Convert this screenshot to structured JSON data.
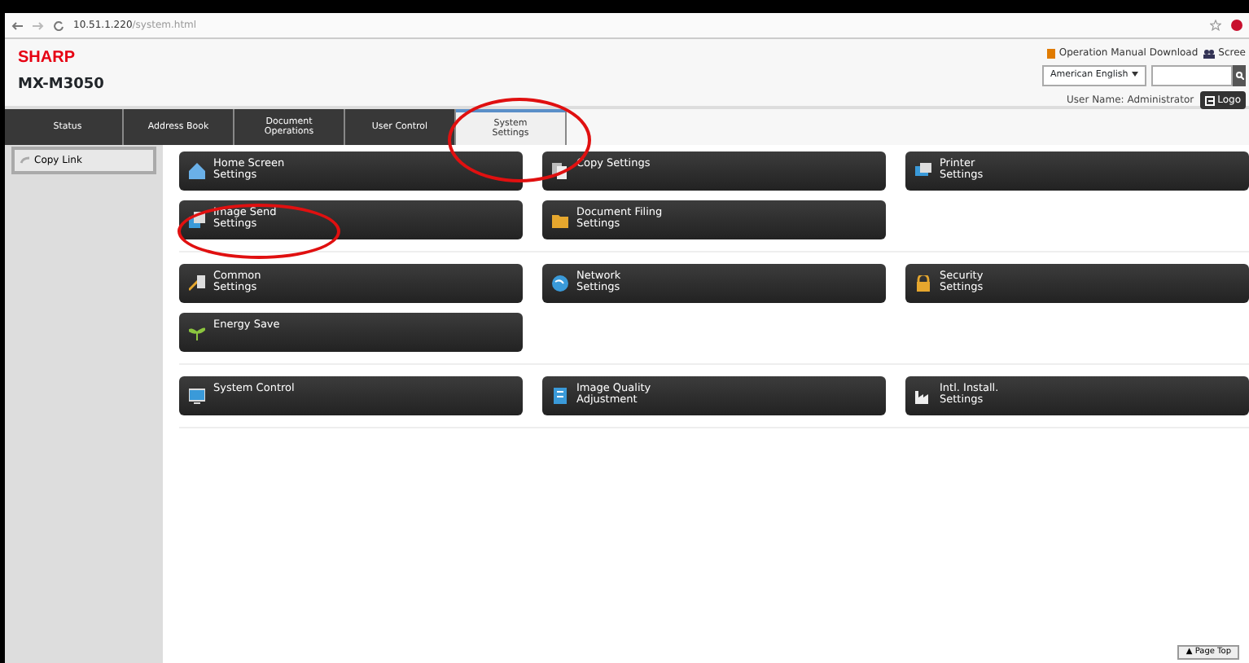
{
  "browser": {
    "url": "10.51.1.220",
    "url_path": "/system.html"
  },
  "header": {
    "brand": "SHARP",
    "model": "MX-M3050",
    "links": [
      {
        "kind": "manual",
        "label": "Operation Manual Download"
      },
      {
        "kind": "screen",
        "label": "Scree"
      }
    ],
    "language": "American English",
    "user_label": "User Name:",
    "user_name": "Administrator",
    "logout": "Logo"
  },
  "tabs": [
    {
      "label": "Status",
      "selected": false,
      "highlighted": false
    },
    {
      "label": "Address Book",
      "selected": false,
      "highlighted": false
    },
    {
      "label": "Document\nOperations",
      "selected": false,
      "highlighted": false
    },
    {
      "label": "User Control",
      "selected": false,
      "highlighted": false
    },
    {
      "label": "System\nSettings",
      "selected": true,
      "highlighted": true
    }
  ],
  "sidebar": {
    "items": [
      {
        "label": "Copy Link"
      }
    ]
  },
  "groups": [
    {
      "tiles": [
        {
          "label": "Home Screen\nSettings",
          "highlighted": false
        },
        {
          "label": "Copy Settings",
          "highlighted": false
        },
        {
          "label": "Printer\nSettings",
          "highlighted": false
        },
        {
          "label": "Image Send\nSettings",
          "highlighted": true
        },
        {
          "label": "Document Filing\nSettings",
          "highlighted": false
        }
      ]
    },
    {
      "tiles": [
        {
          "label": "Common\nSettings",
          "highlighted": false
        },
        {
          "label": "Network\nSettings",
          "highlighted": false
        },
        {
          "label": "Security\nSettings",
          "highlighted": false
        },
        {
          "label": "Energy Save",
          "highlighted": false
        }
      ]
    },
    {
      "tiles": [
        {
          "label": "System Control",
          "highlighted": false
        },
        {
          "label": "Image Quality\nAdjustment",
          "highlighted": false
        },
        {
          "label": "Intl. Install.\nSettings",
          "highlighted": false
        }
      ]
    }
  ],
  "page_top": "▲ Page Top"
}
